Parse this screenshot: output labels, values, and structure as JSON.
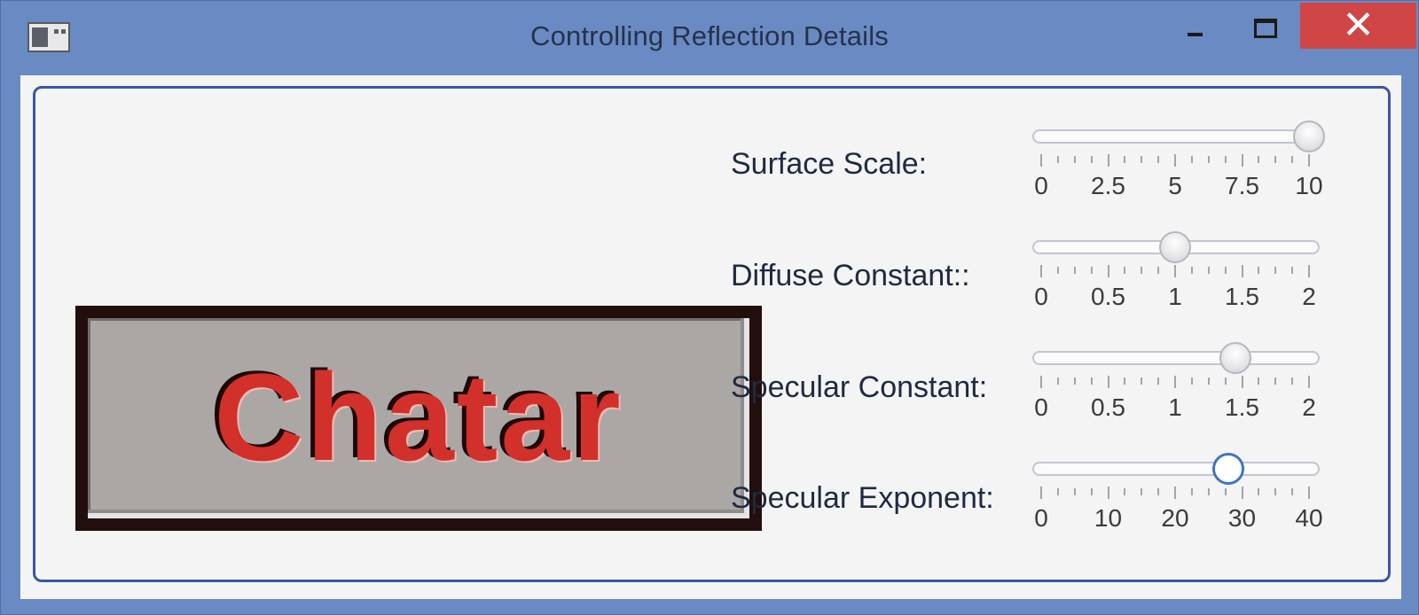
{
  "window": {
    "title": "Controlling Reflection Details",
    "buttons": {
      "minimize": "minimize-icon",
      "maximize": "maximize-icon",
      "close": "✕"
    },
    "close_color": "#d04545",
    "frame_color": "#6a8ac4"
  },
  "preview": {
    "text": "Chatar",
    "text_color": "#d2302b",
    "background": "#aaa7a5"
  },
  "controls": [
    {
      "label": "Surface Scale:",
      "min": 0,
      "max": 10,
      "value": 10,
      "focused": false,
      "tick_labels": [
        "0",
        "2.5",
        "5",
        "7.5",
        "10"
      ]
    },
    {
      "label": "Diffuse Constant::",
      "min": 0,
      "max": 2,
      "value": 1,
      "focused": false,
      "tick_labels": [
        "0",
        "0.5",
        "1",
        "1.5",
        "2"
      ]
    },
    {
      "label": "Specular Constant:",
      "min": 0,
      "max": 2,
      "value": 1.45,
      "focused": false,
      "tick_labels": [
        "0",
        "0.5",
        "1",
        "1.5",
        "2"
      ]
    },
    {
      "label": "Specular Exponent:",
      "min": 0,
      "max": 40,
      "value": 28,
      "focused": true,
      "tick_labels": [
        "0",
        "10",
        "20",
        "30",
        "40"
      ]
    }
  ]
}
